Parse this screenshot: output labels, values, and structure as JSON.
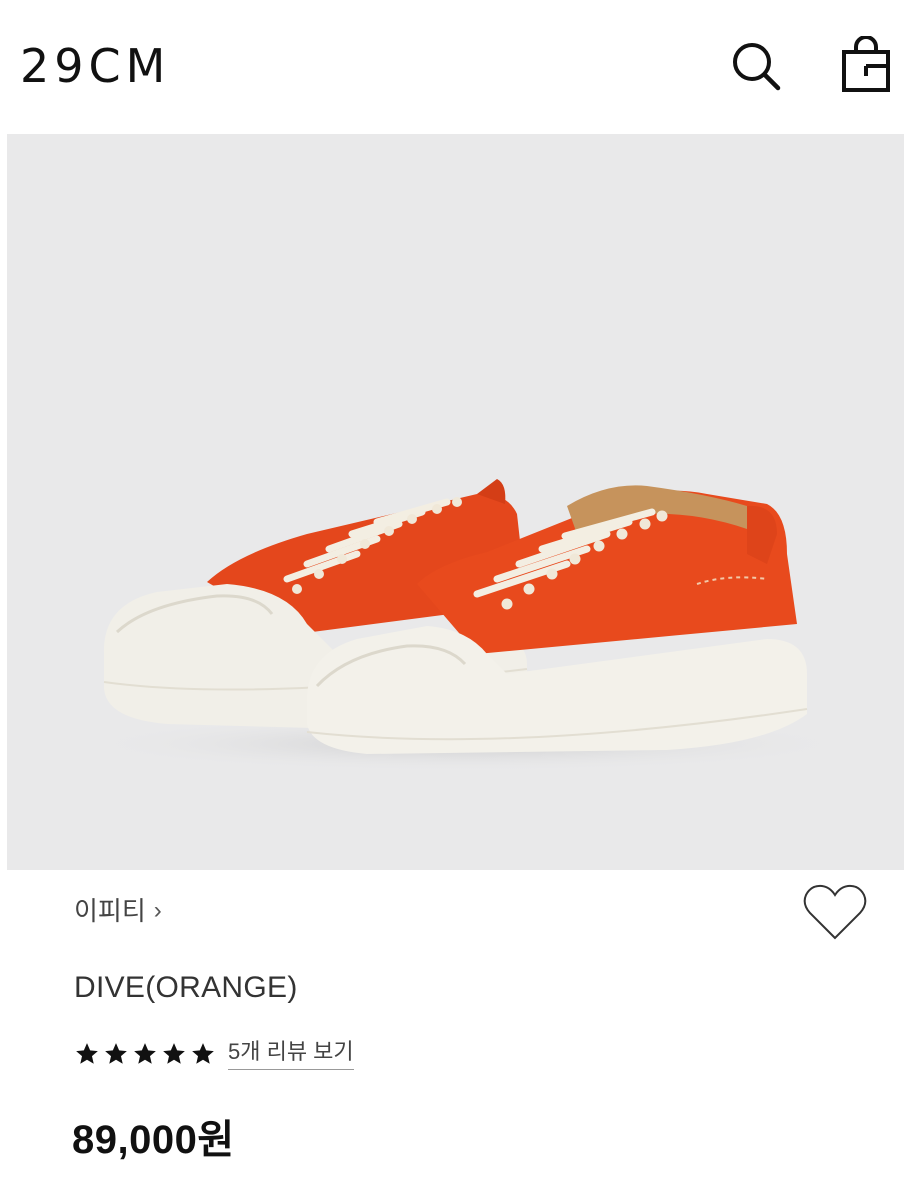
{
  "header": {
    "logo": "29CM",
    "icons": {
      "search": "search-icon",
      "bag": "shopping-bag-icon"
    }
  },
  "product": {
    "image_alt": "Orange canvas low-top sneakers with white platform soles",
    "brand": "이피티",
    "brand_chevron": "›",
    "name": "DIVE(ORANGE)",
    "rating": 5,
    "rating_max": 5,
    "review_link": "5개 리뷰 보기",
    "price": "89,000원"
  },
  "colors": {
    "background": "#ffffff",
    "image_background": "#e9e9ea",
    "shoe_orange": "#e8481c",
    "sole": "#f2f0ea",
    "text": "#111111"
  }
}
